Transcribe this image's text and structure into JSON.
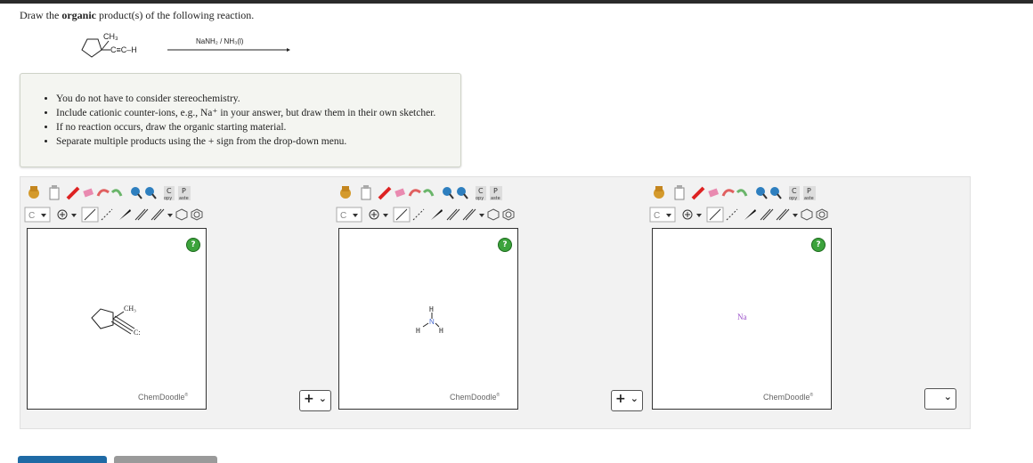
{
  "prompt": {
    "before": "Draw the ",
    "bold": "organic",
    "after": " product(s) of the following reaction."
  },
  "reaction": {
    "reagent": "NaNH₂ / NH₃(l)",
    "substituent": "CH₃",
    "alkyne": "C≡C–H"
  },
  "instructions": [
    "You do not have to consider stereochemistry.",
    "Include cationic counter-ions, e.g., Na⁺ in your answer, but draw them in their own sketcher.",
    "If no reaction occurs, draw the organic starting material.",
    "Separate multiple products using the + sign from the drop-down menu."
  ],
  "sketchers": [
    {
      "brand": "ChemDoodle",
      "help_label": "?",
      "atom_select": "C",
      "copy_label": "opy",
      "paste_label": "aste",
      "copy_top": "C",
      "paste_top": "P",
      "molecule": "cyclopentyl-acetylide",
      "labels": {
        "methyl": "CH₃",
        "carbanion": "C:"
      }
    },
    {
      "brand": "ChemDoodle",
      "help_label": "?",
      "atom_select": "C",
      "copy_label": "opy",
      "paste_label": "aste",
      "copy_top": "C",
      "paste_top": "P",
      "molecule": "ammonia",
      "labels": {
        "h_top": "H",
        "h_left": "H",
        "h_right": "H",
        "n": "N"
      }
    },
    {
      "brand": "ChemDoodle",
      "help_label": "?",
      "atom_select": "C",
      "copy_label": "opy",
      "paste_label": "aste",
      "copy_top": "C",
      "paste_top": "P",
      "molecule": "sodium",
      "labels": {
        "na": "Na"
      }
    }
  ],
  "separators": [
    {
      "value": "+"
    },
    {
      "value": "+"
    },
    {
      "value": ""
    }
  ],
  "colors": {
    "nitrogen": "#4a6ad0",
    "sodium": "#9b4fc9",
    "help": "#3ca33c",
    "primary_button": "#1f6aa5"
  }
}
